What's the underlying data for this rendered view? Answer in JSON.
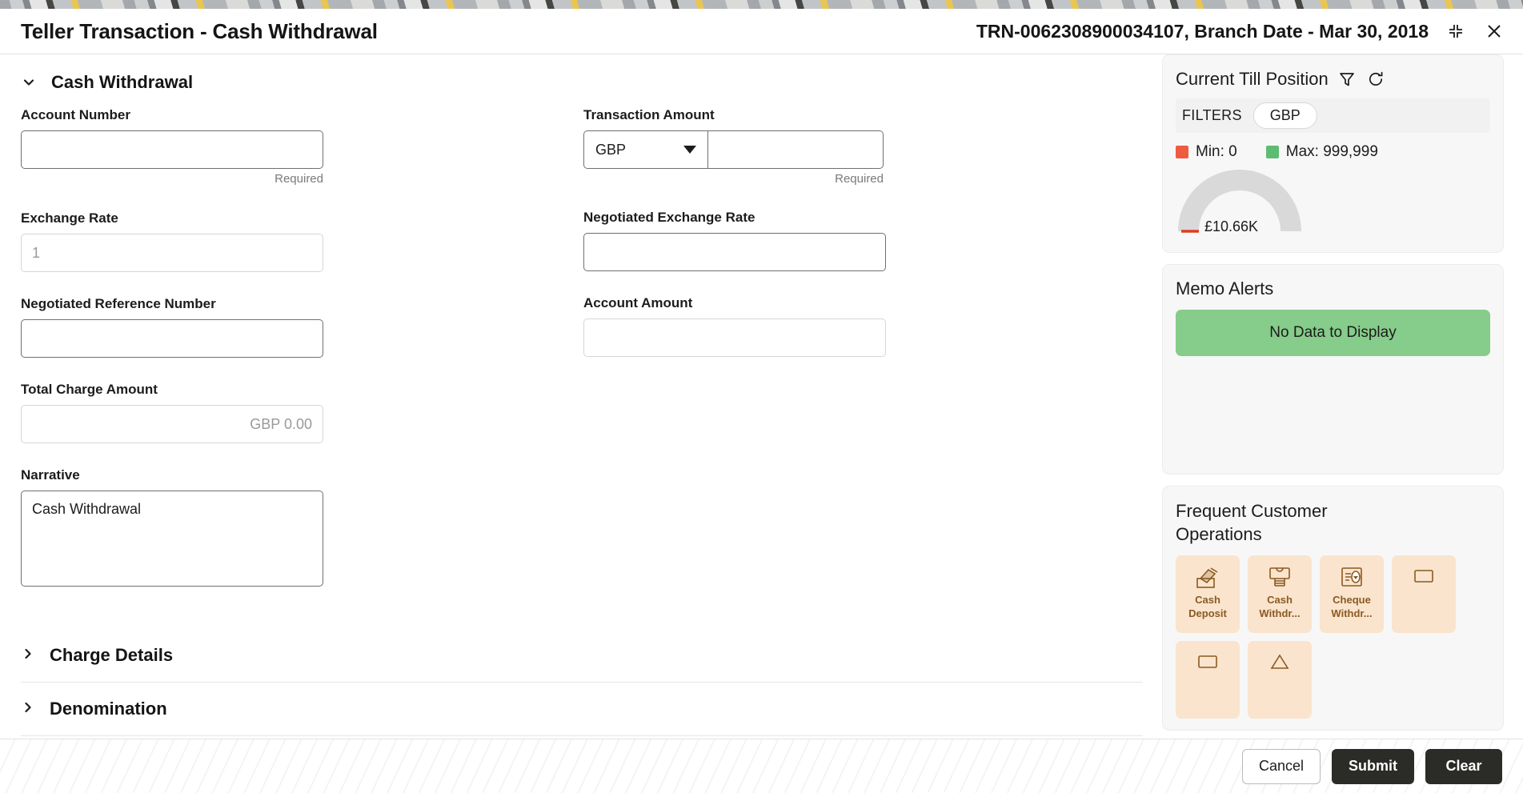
{
  "header": {
    "title": "Teller Transaction - Cash Withdrawal",
    "transaction_ref": "TRN-0062308900034107, Branch Date - Mar 30, 2018",
    "minimize_icon": "collapse-icon",
    "close_icon": "close-icon"
  },
  "main": {
    "section": {
      "title": "Cash Withdrawal",
      "expanded": true,
      "chevron": "chevron-down-icon"
    },
    "fields": {
      "account_number": {
        "label": "Account Number",
        "value": "",
        "placeholder": "",
        "note": "Required"
      },
      "exchange_rate": {
        "label": "Exchange Rate",
        "value": "",
        "placeholder": "1"
      },
      "negotiated_reference_number": {
        "label": "Negotiated Reference Number",
        "value": "",
        "placeholder": ""
      },
      "total_charge_amount": {
        "label": "Total Charge Amount",
        "value": "",
        "placeholder": "GBP 0.00"
      },
      "narrative": {
        "label": "Narrative",
        "value": "Cash Withdrawal"
      },
      "transaction_amount": {
        "label": "Transaction Amount",
        "currency": "GBP",
        "value": "",
        "placeholder": "",
        "note": "Required"
      },
      "negotiated_exchange_rate": {
        "label": "Negotiated Exchange Rate",
        "value": "",
        "placeholder": ""
      },
      "account_amount": {
        "label": "Account Amount",
        "value": "",
        "placeholder": ""
      }
    },
    "collapsed_sections": [
      {
        "title": "Charge Details",
        "chevron": "chevron-right-icon"
      },
      {
        "title": "Denomination",
        "chevron": "chevron-right-icon"
      }
    ]
  },
  "sidebar": {
    "till_position": {
      "title": "Current Till Position",
      "filter_icon": "filter-icon",
      "refresh_icon": "refresh-icon",
      "filters_label": "FILTERS",
      "filter_chip": "GBP",
      "min_label": "Min: 0",
      "max_label": "Max: 999,999",
      "min_color": "#ef5b41",
      "max_color": "#5cbd72",
      "gauge_value": "£10.66K"
    },
    "memo_alerts": {
      "title": "Memo Alerts",
      "empty_message": "No Data to Display",
      "banner_color": "#86cc8a"
    },
    "frequent_customer_operations": {
      "title": "Frequent Customer Operations",
      "tiles": [
        {
          "line1": "Cash",
          "line2": "Deposit",
          "icon": "cash-deposit-icon"
        },
        {
          "line1": "Cash",
          "line2": "Withdr...",
          "icon": "cash-withdrawal-icon"
        },
        {
          "line1": "Cheque",
          "line2": "Withdr...",
          "icon": "cheque-withdrawal-icon"
        },
        {
          "line1": "",
          "line2": "",
          "icon": "operation-icon"
        },
        {
          "line1": "",
          "line2": "",
          "icon": "operation-icon"
        },
        {
          "line1": "",
          "line2": "",
          "icon": "operation-icon"
        }
      ]
    }
  },
  "footer": {
    "cancel_label": "Cancel",
    "submit_label": "Submit",
    "clear_label": "Clear"
  },
  "chart_data": {
    "type": "gauge",
    "title": "Current Till Position",
    "value": 10660,
    "value_label": "£10.66K",
    "min": 0,
    "max": 999999,
    "min_label": "Min: 0",
    "max_label": "Max: 999,999",
    "currency": "GBP",
    "min_color": "#ef5b41",
    "max_color": "#5cbd72",
    "track_color": "#d9d9d9",
    "legend_position": "top"
  }
}
